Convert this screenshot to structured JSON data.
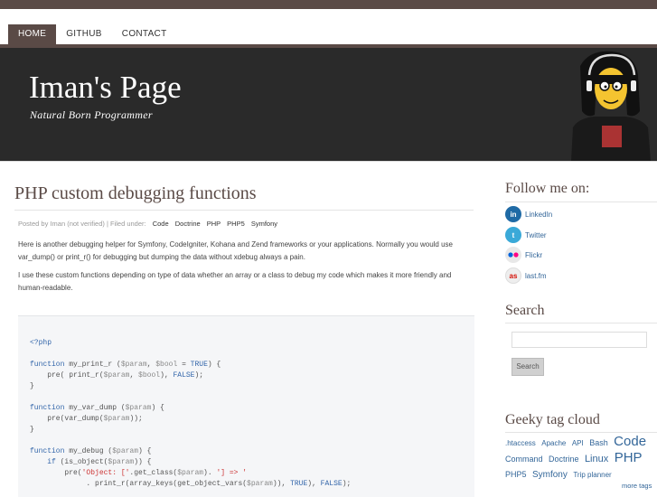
{
  "nav": {
    "items": [
      "HOME",
      "GITHUB",
      "CONTACT"
    ],
    "active": "HOME"
  },
  "header": {
    "title": "Iman's Page",
    "tagline": "Natural Born Programmer"
  },
  "post": {
    "title": "PHP custom debugging functions",
    "meta_prefix": "Posted by Iman (not verified) | Filed under:",
    "tags": [
      "Code",
      "Doctrine",
      "PHP",
      "PHP5",
      "Symfony"
    ],
    "para1": "Here is another debugging helper for Symfony, CodeIgniter, Kohana and Zend frameworks or your applications. Normally you would use var_dump() or print_r() for debugging but dumping the data without xdebug always a pain.",
    "para2": "I use these custom functions depending on type of data whether an array or a class to debug my code which makes it more friendly and human-readable."
  },
  "code": {
    "lines": [
      "<?php",
      "",
      "function my_print_r ($param, $bool = TRUE) {",
      "    pre( print_r($param, $bool), FALSE);",
      "}",
      "",
      "function my_var_dump ($param) {",
      "    pre(var_dump($param));",
      "}",
      "",
      "function my_debug ($param) {",
      "    if (is_object($param)) {",
      "        pre('Object: ['.get_class($param). '] => '",
      "             . print_r(array_keys(get_object_vars($param)), TRUE), FALSE);"
    ]
  },
  "sidebar": {
    "follow_title": "Follow me on:",
    "follow_links": [
      {
        "label": "LinkedIn",
        "icon": "linkedin-icon",
        "color": "#1f6aa5",
        "glyph": "in"
      },
      {
        "label": "Twitter",
        "icon": "twitter-icon",
        "color": "#3aa9d8",
        "glyph": "t"
      },
      {
        "label": "Flickr",
        "icon": "flickr-icon",
        "color": "#e8e8e8",
        "glyph": "••"
      },
      {
        "label": "last.fm",
        "icon": "lastfm-icon",
        "color": "#eeeeee",
        "glyph": "as"
      }
    ],
    "search_title": "Search",
    "search_button": "Search",
    "tags_title": "Geeky tag cloud",
    "tags": [
      {
        "label": ".htaccess",
        "size": 8
      },
      {
        "label": "Apache",
        "size": 8
      },
      {
        "label": "API",
        "size": 8
      },
      {
        "label": "Bash",
        "size": 9
      },
      {
        "label": "Code",
        "size": 15
      },
      {
        "label": "Command",
        "size": 9
      },
      {
        "label": "Doctrine",
        "size": 9
      },
      {
        "label": "Linux",
        "size": 11
      },
      {
        "label": "PHP",
        "size": 15
      },
      {
        "label": "PHP5",
        "size": 9
      },
      {
        "label": "Symfony",
        "size": 10
      },
      {
        "label": "Trip planner",
        "size": 8
      }
    ],
    "more_tags": "more tags"
  },
  "colors": {
    "brand": "#5a4a46",
    "link": "#336699",
    "header_bg": "#2a2a2a"
  }
}
